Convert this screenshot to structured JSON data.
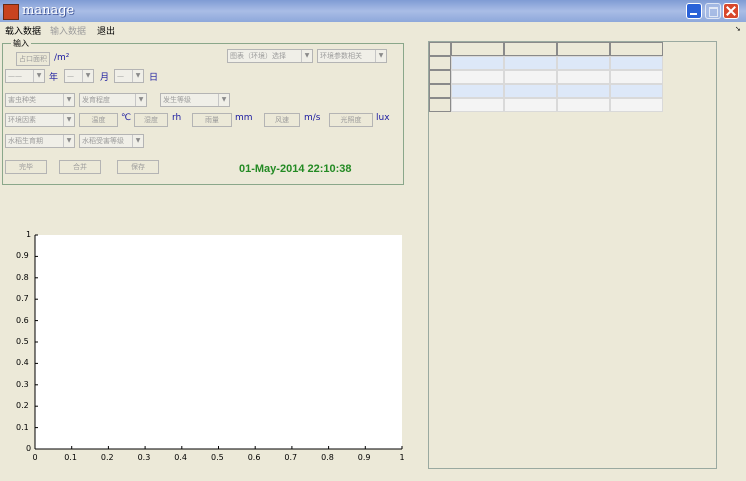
{
  "window": {
    "title": "manage"
  },
  "menu": [
    {
      "label": "载入数据",
      "enabled": true
    },
    {
      "label": "输入数据",
      "enabled": false
    },
    {
      "label": "退出",
      "enabled": true
    }
  ],
  "panel": {
    "legend": "输入",
    "area_btn": "占口面积",
    "area_unit": "/m²",
    "year_value": "——",
    "year_label": "年",
    "month_value": "—",
    "month_label": "月",
    "day_value": "—",
    "day_label": "日",
    "chart_env_select": "图表（环境）选择",
    "env_param_select": "环境参数相关",
    "pest_type": "害虫种类",
    "severity": "发育程度",
    "damage_level": "发生等级",
    "env_factor": "环境因素",
    "temp_btn": "温度",
    "temp_unit": "℃",
    "humidity_btn": "湿度",
    "humidity_unit": "rh",
    "rain_btn": "雨量",
    "rain_unit": "mm",
    "wind_btn": "风速",
    "wind_unit": "m/s",
    "light_btn": "光照度",
    "light_unit": "lux",
    "growth_stage": "水稻生育期",
    "damage_grade": "水稻受害等级",
    "finish_btn": "完毕",
    "merge_btn": "合并",
    "save_btn": "保存",
    "datetime": "01-May-2014 22:10:38"
  },
  "chart_data": {
    "type": "line",
    "series": [],
    "x_ticks": [
      "0",
      "0.1",
      "0.2",
      "0.3",
      "0.4",
      "0.5",
      "0.6",
      "0.7",
      "0.8",
      "0.9",
      "1"
    ],
    "y_ticks": [
      "0",
      "0.1",
      "0.2",
      "0.3",
      "0.4",
      "0.5",
      "0.6",
      "0.7",
      "0.8",
      "0.9",
      "1"
    ],
    "xlim": [
      0,
      1
    ],
    "ylim": [
      0,
      1
    ],
    "grid": false,
    "title": "",
    "xlabel": "",
    "ylabel": ""
  },
  "table": {
    "columns": 4,
    "rows": 4,
    "highlight_rows": [
      0,
      2
    ]
  },
  "colors": {
    "datetime": "#238a23",
    "unit": "#1a1aa0",
    "row_highlight": "#dde8f8"
  }
}
